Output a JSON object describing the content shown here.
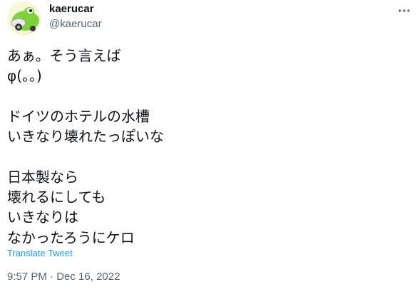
{
  "tweet": {
    "author": {
      "name": "kaerucar",
      "handle": "@kaerucar"
    },
    "lines": [
      "あぁ。そう言えば",
      "φ(。。)",
      "",
      "ドイツのホテルの水槽",
      "いきなり壊れたっぽいな",
      "",
      "日本製なら",
      "壊れるにしても",
      "いきなりは",
      "なかったろうにケロ"
    ],
    "translate_label": "Translate Tweet",
    "time": "9:57 PM",
    "separator": "·",
    "date": "Dec 16, 2022"
  },
  "icons": {
    "avatar": "frog-car-avatar",
    "more": "more-options-icon"
  },
  "colors": {
    "text": "#0f1419",
    "secondary": "#536471",
    "link": "#1d9bf0",
    "avatar_green": "#7fd13b"
  }
}
